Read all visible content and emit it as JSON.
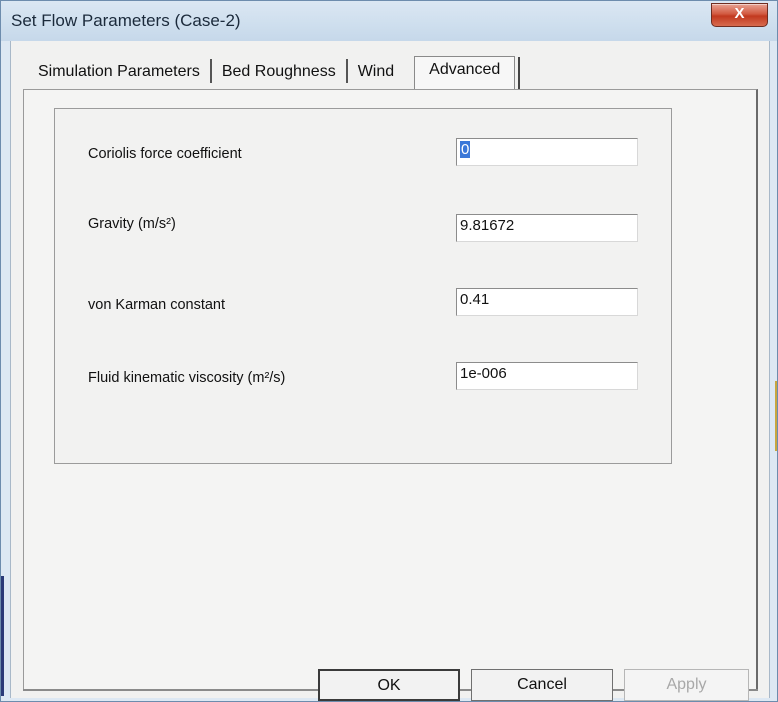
{
  "window": {
    "title": "Set Flow Parameters (Case-2)",
    "close_label": "X"
  },
  "tabs": [
    {
      "label": "Simulation Parameters",
      "active": false
    },
    {
      "label": "Bed Roughness",
      "active": false
    },
    {
      "label": "Wind",
      "active": false
    },
    {
      "label": "Advanced",
      "active": true
    }
  ],
  "advanced": {
    "coriolis": {
      "label": "Coriolis force coefficient",
      "value": "0"
    },
    "gravity": {
      "label": "Gravity (m/s²)",
      "value": "9.81672"
    },
    "von_karman": {
      "label": "von Karman constant",
      "value": "0.41"
    },
    "viscosity": {
      "label": "Fluid kinematic viscosity (m²/s)",
      "value": "1e-006"
    }
  },
  "buttons": {
    "ok": "OK",
    "cancel": "Cancel",
    "apply": "Apply"
  },
  "colors": {
    "close_button": "#c2391f",
    "selection": "#3b78d8"
  }
}
